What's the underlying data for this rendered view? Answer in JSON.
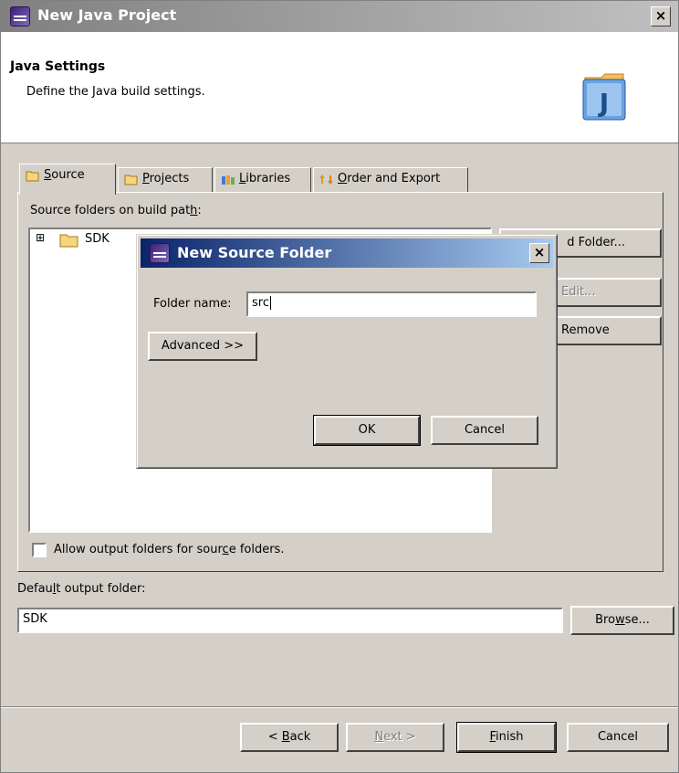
{
  "window": {
    "title": "New Java Project",
    "close": "×"
  },
  "banner": {
    "heading": "Java Settings",
    "description": "Define the Java build settings."
  },
  "tabs": [
    {
      "pre": "",
      "ul": "S",
      "post": "ource"
    },
    {
      "pre": "",
      "ul": "P",
      "post": "rojects"
    },
    {
      "pre": "",
      "ul": "L",
      "post": "ibraries"
    },
    {
      "pre": "",
      "ul": "O",
      "post": "rder and Export"
    }
  ],
  "source": {
    "label_pre": "Source folders on build pat",
    "label_ul": "h",
    "label_post": ":",
    "tree": [
      {
        "label": "SDK",
        "expander": "⊞"
      }
    ],
    "buttons": {
      "add_folder_partial": "d Folder...",
      "edit_partial": "Edit...",
      "remove_partial": "Remove"
    },
    "allow_output_pre": "Allow output folders for sour",
    "allow_output_ul": "c",
    "allow_output_post": "e folders."
  },
  "output": {
    "label_pre": "Defau",
    "label_ul": "l",
    "label_post": "t output folder:",
    "value": "SDK",
    "browse_pre": "Bro",
    "browse_ul": "w",
    "browse_post": "se..."
  },
  "footer": {
    "back_pre": "< ",
    "back_ul": "B",
    "back_post": "ack",
    "next_ul": "N",
    "next_post": "ext >",
    "finish_ul": "F",
    "finish_post": "inish",
    "cancel": "Cancel"
  },
  "dialog": {
    "title": "New Source Folder",
    "close": "×",
    "folder_label": "Folder name:",
    "folder_value": "src",
    "advanced": "Advanced >>",
    "ok": "OK",
    "cancel": "Cancel"
  },
  "colors": {
    "face": "#d4d0c8",
    "active_title": "#0a246a",
    "inactive_title": "#808080"
  }
}
